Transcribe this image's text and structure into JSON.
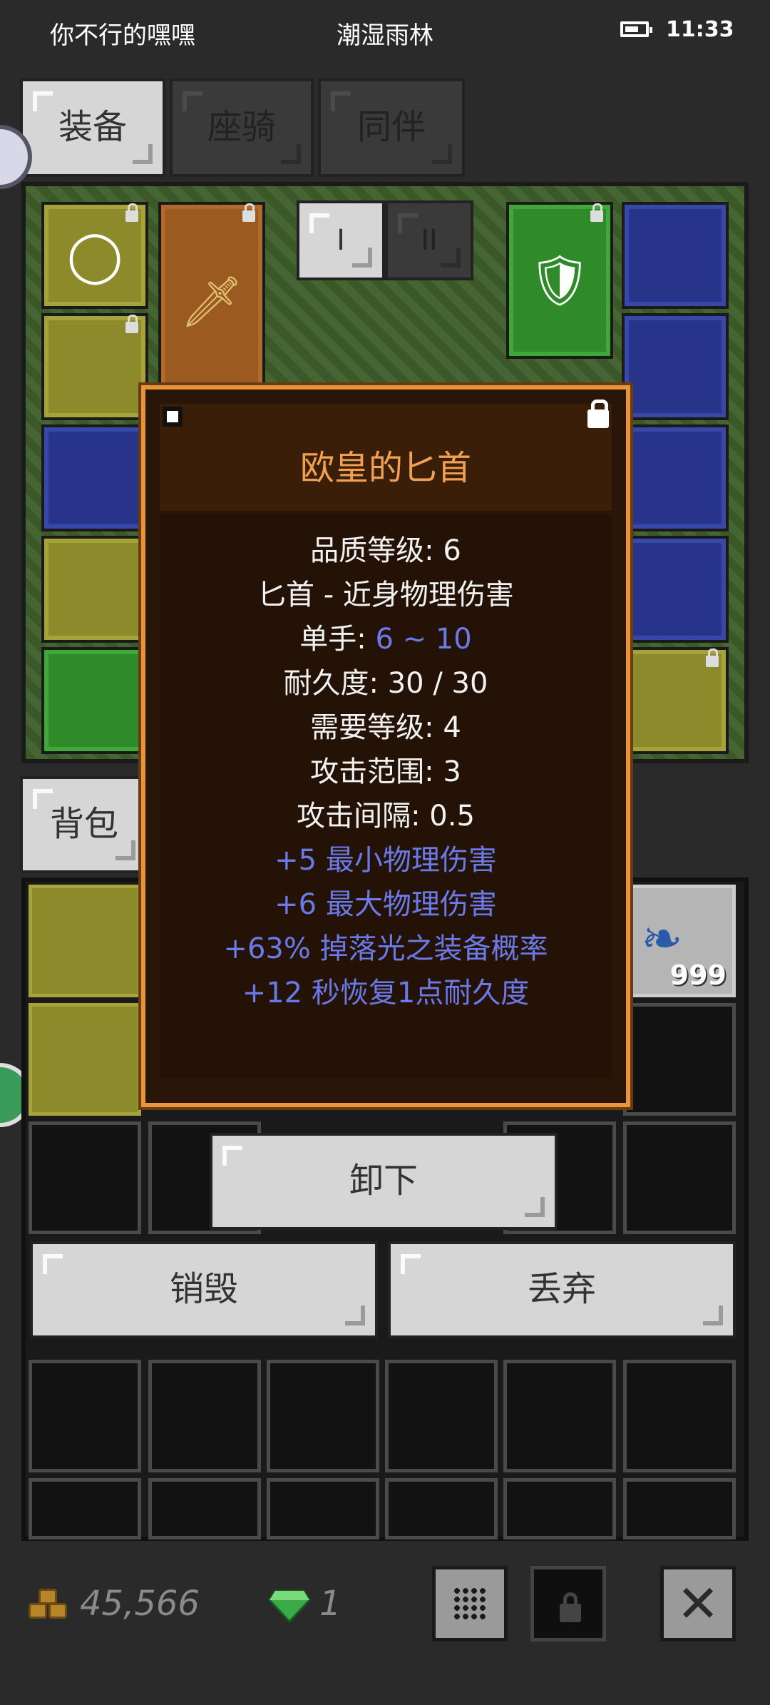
{
  "status_bar": {
    "left_text": "你不行的嘿嘿",
    "center_text": "潮湿雨林",
    "time": "11:33"
  },
  "tabs": [
    {
      "label": "装备",
      "active": true
    },
    {
      "label": "座骑",
      "active": false
    },
    {
      "label": "同伴",
      "active": false
    }
  ],
  "equip_page_buttons": [
    "I",
    "II"
  ],
  "bag_tab": {
    "label": "背包"
  },
  "bag_item_count": "999",
  "tooltip": {
    "title": "欧皇的匕首",
    "quality": "品质等级: 6",
    "type_line": "匕首 - 近身物理伤害",
    "damage_label": "单手: ",
    "damage_value": "6 ~ 10",
    "durability": "耐久度: 30 / 30",
    "req_level": "需要等级: 4",
    "attack_range": "攻击范围: 3",
    "attack_interval": "攻击间隔: 0.5",
    "affixes": [
      "+5 最小物理伤害",
      "+6 最大物理伤害",
      "+63% 掉落光之装备概率",
      "+12 秒恢复1点耐久度"
    ]
  },
  "actions": {
    "unequip": "卸下",
    "destroy": "销毁",
    "discard": "丢弃"
  },
  "currency": {
    "gold": "45,566",
    "gems": "1"
  },
  "colors": {
    "tooltip_border": "#e8943a",
    "title": "#f0a050",
    "affix_blue": "#6a7ae8"
  },
  "icons": [
    "battery-icon",
    "lock-icon",
    "pin-icon",
    "gold-coins-icon",
    "green-gem-icon",
    "grid-icon",
    "close-icon"
  ]
}
